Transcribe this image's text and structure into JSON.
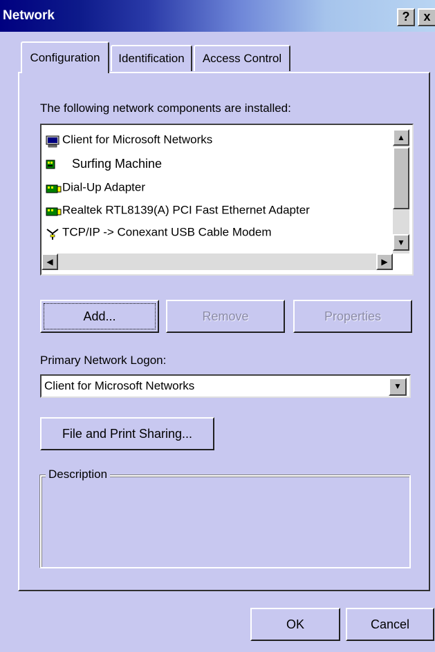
{
  "window": {
    "title": "Network",
    "help_button": "?",
    "close_button": "x"
  },
  "tabs": [
    {
      "label": "Configuration",
      "selected": true
    },
    {
      "label": "Identification",
      "selected": false
    },
    {
      "label": "Access Control",
      "selected": false
    }
  ],
  "components": {
    "label": "The following network components are installed:",
    "items": [
      {
        "label": "Client for Microsoft Networks",
        "icon": "computer-icon"
      },
      {
        "label": "Surfing Machine",
        "icon": "network-card-icon"
      },
      {
        "label": "Dial-Up Adapter",
        "icon": "network-card-icon"
      },
      {
        "label": "Realtek RTL8139(A) PCI Fast Ethernet Adapter",
        "icon": "network-card-icon"
      },
      {
        "label": "TCP/IP -> Conexant USB Cable Modem",
        "icon": "protocol-icon"
      }
    ]
  },
  "buttons": {
    "add": "Add...",
    "remove": "Remove",
    "properties": "Properties",
    "file_print_sharing": "File and Print Sharing...",
    "ok": "OK",
    "cancel": "Cancel"
  },
  "logon": {
    "label": "Primary Network Logon:",
    "value": "Client for Microsoft Networks"
  },
  "description": {
    "legend": "Description",
    "text": ""
  },
  "colors": {
    "dialog_background": "#c8c8f0",
    "title_bar_start": "#000080"
  }
}
